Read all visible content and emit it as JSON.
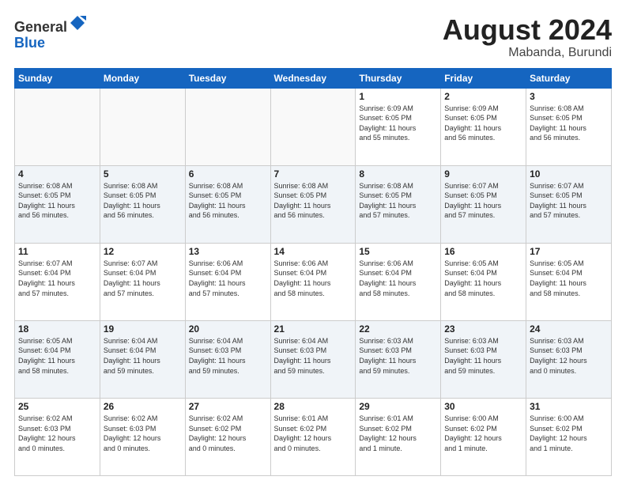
{
  "header": {
    "logo_general": "General",
    "logo_blue": "Blue",
    "month_year": "August 2024",
    "location": "Mabanda, Burundi"
  },
  "weekdays": [
    "Sunday",
    "Monday",
    "Tuesday",
    "Wednesday",
    "Thursday",
    "Friday",
    "Saturday"
  ],
  "weeks": [
    [
      {
        "day": "",
        "info": ""
      },
      {
        "day": "",
        "info": ""
      },
      {
        "day": "",
        "info": ""
      },
      {
        "day": "",
        "info": ""
      },
      {
        "day": "1",
        "info": "Sunrise: 6:09 AM\nSunset: 6:05 PM\nDaylight: 11 hours\nand 55 minutes."
      },
      {
        "day": "2",
        "info": "Sunrise: 6:09 AM\nSunset: 6:05 PM\nDaylight: 11 hours\nand 56 minutes."
      },
      {
        "day": "3",
        "info": "Sunrise: 6:08 AM\nSunset: 6:05 PM\nDaylight: 11 hours\nand 56 minutes."
      }
    ],
    [
      {
        "day": "4",
        "info": "Sunrise: 6:08 AM\nSunset: 6:05 PM\nDaylight: 11 hours\nand 56 minutes."
      },
      {
        "day": "5",
        "info": "Sunrise: 6:08 AM\nSunset: 6:05 PM\nDaylight: 11 hours\nand 56 minutes."
      },
      {
        "day": "6",
        "info": "Sunrise: 6:08 AM\nSunset: 6:05 PM\nDaylight: 11 hours\nand 56 minutes."
      },
      {
        "day": "7",
        "info": "Sunrise: 6:08 AM\nSunset: 6:05 PM\nDaylight: 11 hours\nand 56 minutes."
      },
      {
        "day": "8",
        "info": "Sunrise: 6:08 AM\nSunset: 6:05 PM\nDaylight: 11 hours\nand 57 minutes."
      },
      {
        "day": "9",
        "info": "Sunrise: 6:07 AM\nSunset: 6:05 PM\nDaylight: 11 hours\nand 57 minutes."
      },
      {
        "day": "10",
        "info": "Sunrise: 6:07 AM\nSunset: 6:05 PM\nDaylight: 11 hours\nand 57 minutes."
      }
    ],
    [
      {
        "day": "11",
        "info": "Sunrise: 6:07 AM\nSunset: 6:04 PM\nDaylight: 11 hours\nand 57 minutes."
      },
      {
        "day": "12",
        "info": "Sunrise: 6:07 AM\nSunset: 6:04 PM\nDaylight: 11 hours\nand 57 minutes."
      },
      {
        "day": "13",
        "info": "Sunrise: 6:06 AM\nSunset: 6:04 PM\nDaylight: 11 hours\nand 57 minutes."
      },
      {
        "day": "14",
        "info": "Sunrise: 6:06 AM\nSunset: 6:04 PM\nDaylight: 11 hours\nand 58 minutes."
      },
      {
        "day": "15",
        "info": "Sunrise: 6:06 AM\nSunset: 6:04 PM\nDaylight: 11 hours\nand 58 minutes."
      },
      {
        "day": "16",
        "info": "Sunrise: 6:05 AM\nSunset: 6:04 PM\nDaylight: 11 hours\nand 58 minutes."
      },
      {
        "day": "17",
        "info": "Sunrise: 6:05 AM\nSunset: 6:04 PM\nDaylight: 11 hours\nand 58 minutes."
      }
    ],
    [
      {
        "day": "18",
        "info": "Sunrise: 6:05 AM\nSunset: 6:04 PM\nDaylight: 11 hours\nand 58 minutes."
      },
      {
        "day": "19",
        "info": "Sunrise: 6:04 AM\nSunset: 6:04 PM\nDaylight: 11 hours\nand 59 minutes."
      },
      {
        "day": "20",
        "info": "Sunrise: 6:04 AM\nSunset: 6:03 PM\nDaylight: 11 hours\nand 59 minutes."
      },
      {
        "day": "21",
        "info": "Sunrise: 6:04 AM\nSunset: 6:03 PM\nDaylight: 11 hours\nand 59 minutes."
      },
      {
        "day": "22",
        "info": "Sunrise: 6:03 AM\nSunset: 6:03 PM\nDaylight: 11 hours\nand 59 minutes."
      },
      {
        "day": "23",
        "info": "Sunrise: 6:03 AM\nSunset: 6:03 PM\nDaylight: 11 hours\nand 59 minutes."
      },
      {
        "day": "24",
        "info": "Sunrise: 6:03 AM\nSunset: 6:03 PM\nDaylight: 12 hours\nand 0 minutes."
      }
    ],
    [
      {
        "day": "25",
        "info": "Sunrise: 6:02 AM\nSunset: 6:03 PM\nDaylight: 12 hours\nand 0 minutes."
      },
      {
        "day": "26",
        "info": "Sunrise: 6:02 AM\nSunset: 6:03 PM\nDaylight: 12 hours\nand 0 minutes."
      },
      {
        "day": "27",
        "info": "Sunrise: 6:02 AM\nSunset: 6:02 PM\nDaylight: 12 hours\nand 0 minutes."
      },
      {
        "day": "28",
        "info": "Sunrise: 6:01 AM\nSunset: 6:02 PM\nDaylight: 12 hours\nand 0 minutes."
      },
      {
        "day": "29",
        "info": "Sunrise: 6:01 AM\nSunset: 6:02 PM\nDaylight: 12 hours\nand 1 minute."
      },
      {
        "day": "30",
        "info": "Sunrise: 6:00 AM\nSunset: 6:02 PM\nDaylight: 12 hours\nand 1 minute."
      },
      {
        "day": "31",
        "info": "Sunrise: 6:00 AM\nSunset: 6:02 PM\nDaylight: 12 hours\nand 1 minute."
      }
    ]
  ]
}
